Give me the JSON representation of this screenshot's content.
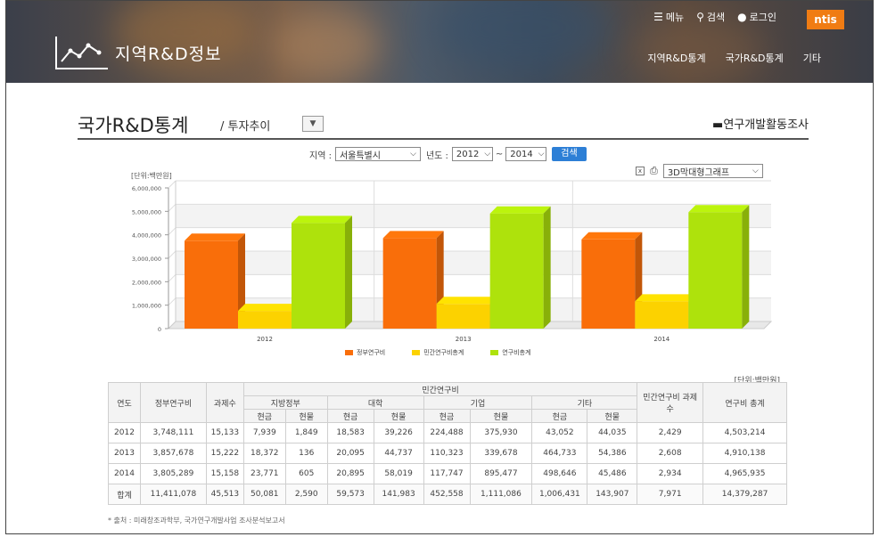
{
  "header": {
    "logo_text": "지역R&D정보",
    "util": {
      "menu": "메뉴",
      "search": "검색",
      "login": "로그인"
    },
    "badge": "ntis",
    "nav": [
      "지역R&D통계",
      "국가R&D통계",
      "기타"
    ]
  },
  "page": {
    "title": "국가R&D통계",
    "subtitle": "/ 투자추이",
    "survey_link": "연구개발활동조사"
  },
  "filter": {
    "region_label": "지역 :",
    "region_value": "서울특별시",
    "year_label": "년도 :",
    "year_from": "2012",
    "tilde": "~",
    "year_to": "2014",
    "search_button": "검색"
  },
  "chart_tools": {
    "graph_type": "3D막대형그래프"
  },
  "chart_data": {
    "type": "bar",
    "unit_label": "[단위:백만원]",
    "categories": [
      "2012",
      "2013",
      "2014"
    ],
    "series": [
      {
        "name": "정부연구비",
        "values": [
          3748111,
          3857678,
          3805289
        ],
        "color": "#f96e0a"
      },
      {
        "name": "민간연구비총계",
        "values": [
          755102,
          1052460,
          1160646
        ],
        "color": "#fcd200"
      },
      {
        "name": "연구비총계",
        "values": [
          4503214,
          4910138,
          4965935
        ],
        "color": "#aee20c"
      }
    ],
    "ylim": [
      0,
      6000000
    ],
    "yticks": [
      "6,000,000",
      "5,000,000",
      "4,000,000",
      "3,000,000",
      "2,000,000",
      "1,000,000",
      "0"
    ],
    "ytick_values": [
      6000000,
      5000000,
      4000000,
      3000000,
      2000000,
      1000000,
      0
    ],
    "grid": true,
    "legend_position": "bottom"
  },
  "table": {
    "unit": "[단위:백만원]",
    "headers": {
      "year": "연도",
      "gov": "정부연구비",
      "count": "과제수",
      "private": "민간연구비",
      "local_gov": "지방정부",
      "univ": "대학",
      "corp": "기업",
      "etc": "기타",
      "cash": "현금",
      "kind": "현물",
      "private_count": "민간연구비 과제수",
      "total": "연구비 총계"
    },
    "rows": [
      [
        "2012",
        "3,748,111",
        "15,133",
        "7,939",
        "1,849",
        "18,583",
        "39,226",
        "224,488",
        "375,930",
        "43,052",
        "44,035",
        "2,429",
        "4,503,214"
      ],
      [
        "2013",
        "3,857,678",
        "15,222",
        "18,372",
        "136",
        "20,095",
        "44,737",
        "110,323",
        "339,678",
        "464,733",
        "54,386",
        "2,608",
        "4,910,138"
      ],
      [
        "2014",
        "3,805,289",
        "15,158",
        "23,771",
        "605",
        "20,895",
        "58,019",
        "117,747",
        "895,477",
        "498,646",
        "45,486",
        "2,934",
        "4,965,935"
      ],
      [
        "합계",
        "11,411,078",
        "45,513",
        "50,081",
        "2,590",
        "59,573",
        "141,983",
        "452,558",
        "1,111,086",
        "1,006,431",
        "143,907",
        "7,971",
        "14,379,287"
      ]
    ]
  },
  "source_note": "* 출처 : 미래창조과학부, 국가연구개발사업 조사분석보고서"
}
